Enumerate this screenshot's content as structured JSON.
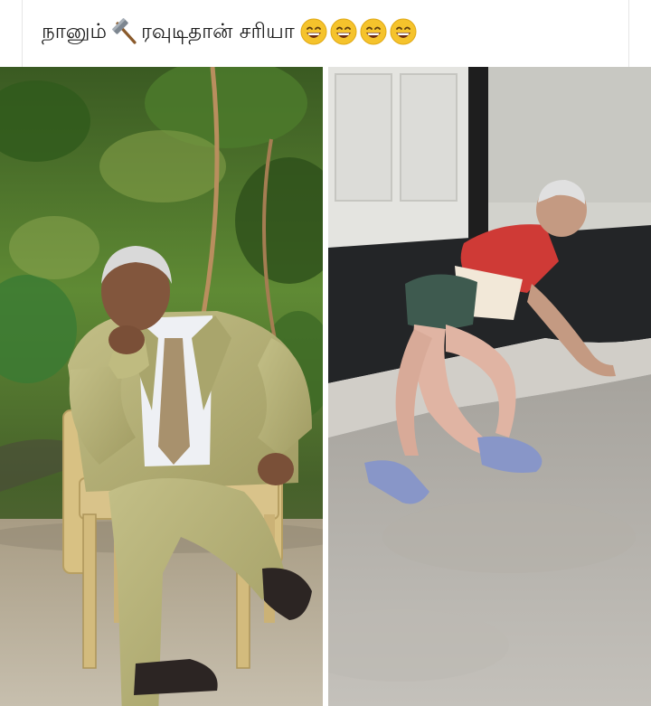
{
  "post": {
    "caption_part1": "நானும்",
    "caption_icon": "hammer-icon",
    "caption_part2": "ரவுடிதான் சரியா",
    "caption_emojis": [
      "grin-emoji",
      "grin-emoji",
      "grin-emoji",
      "grin-emoji"
    ]
  },
  "images": {
    "left": "photo-seated-man-in-suit",
    "right": "photo-man-fallen-on-doorstep"
  },
  "colors": {
    "suit": "#b7b37a",
    "foliage": "#3f6b2a",
    "shirt_red": "#cf3a36",
    "shorts": "#3e5a4f",
    "pavement": "#b9b5ad",
    "emoji_yellow": "#f5c32c"
  }
}
